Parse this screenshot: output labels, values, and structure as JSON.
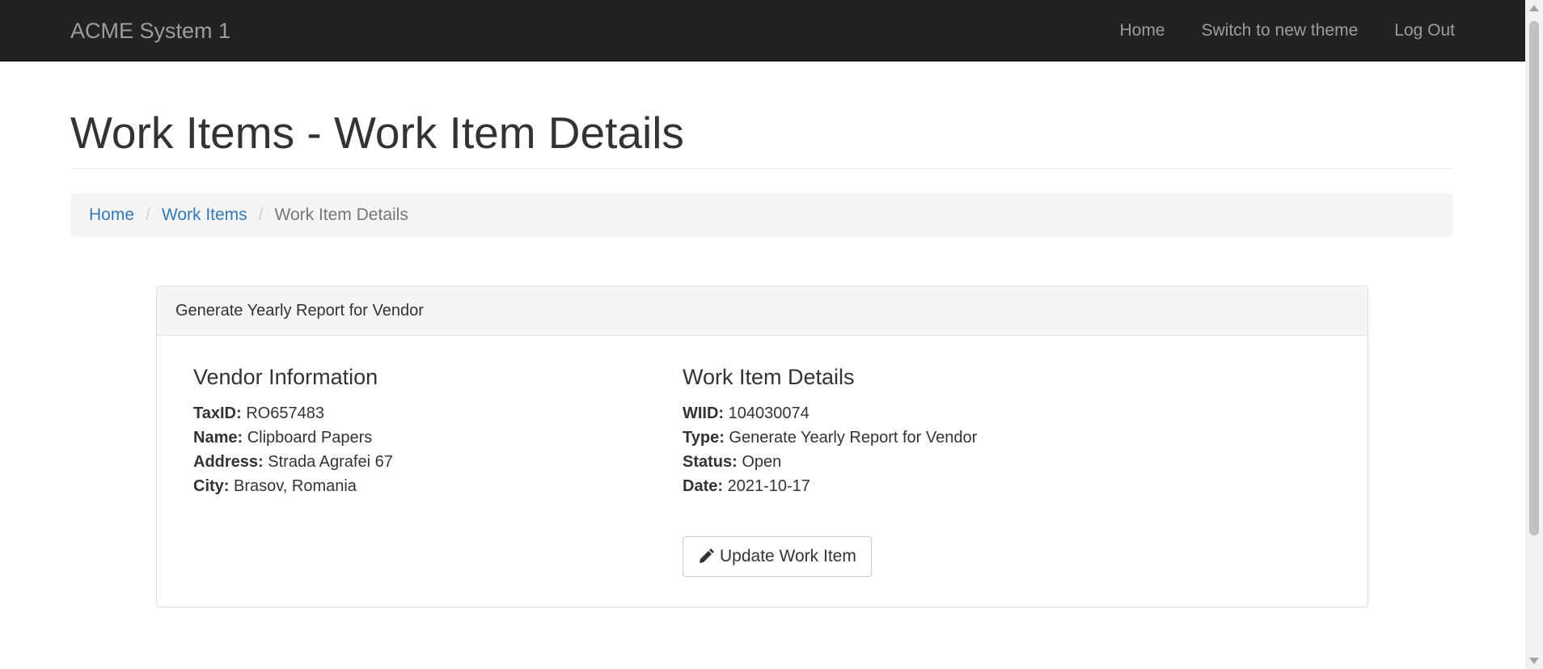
{
  "navbar": {
    "brand": "ACME System 1",
    "links": [
      "Home",
      "Switch to new theme",
      "Log Out"
    ]
  },
  "page": {
    "title": "Work Items - Work Item Details"
  },
  "breadcrumb": {
    "items": [
      "Home",
      "Work Items"
    ],
    "active": "Work Item Details"
  },
  "panel": {
    "heading": "Generate Yearly Report for Vendor",
    "vendor": {
      "title": "Vendor Information",
      "taxid_label": "TaxID:",
      "taxid": "RO657483",
      "name_label": "Name:",
      "name": "Clipboard Papers",
      "address_label": "Address:",
      "address": "Strada Agrafei 67",
      "city_label": "City:",
      "city": "Brasov, Romania"
    },
    "work_item": {
      "title": "Work Item Details",
      "wiid_label": "WIID:",
      "wiid": "104030074",
      "type_label": "Type:",
      "type": "Generate Yearly Report for Vendor",
      "status_label": "Status:",
      "status": "Open",
      "date_label": "Date:",
      "date": "2021-10-17"
    },
    "update_button": "Update Work Item",
    "update_icon": "pencil-icon"
  },
  "colors": {
    "navbar_bg": "#222222",
    "link": "#337ab7",
    "nav_text": "#9d9d9d"
  }
}
